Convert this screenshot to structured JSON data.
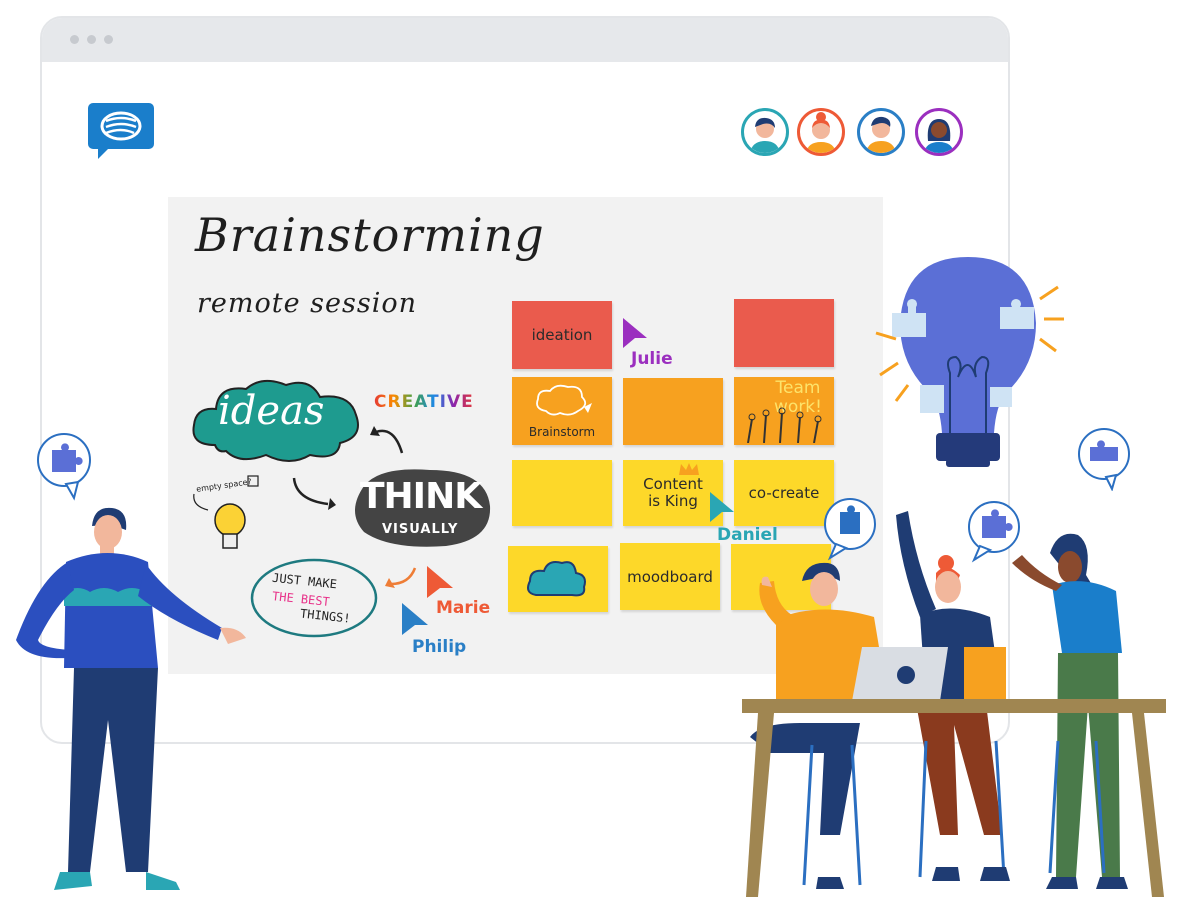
{
  "board": {
    "title": "Brainstorming",
    "subtitle": "remote session",
    "doodles": {
      "ideas": "ideas",
      "creative": "CREATIVE",
      "think": "THINK",
      "visually": "VISUALLY",
      "empty_space": "empty space?",
      "just_make_line1": "JUST MAKE",
      "just_make_line2": "THE BEST",
      "just_make_line3": "THINGS!"
    },
    "notes": [
      {
        "text": "ideation",
        "color": "#ea5b4d"
      },
      {
        "text": "",
        "color": "#ea5b4d"
      },
      {
        "text": "Brainstorm",
        "color": "#f7a11f"
      },
      {
        "text": "",
        "color": "#f7a11f"
      },
      {
        "text": "Team work!",
        "color": "#f7a11f"
      },
      {
        "text": "",
        "color": "#fdd829"
      },
      {
        "text": "Content is King",
        "color": "#fdd829"
      },
      {
        "text": "co-create",
        "color": "#fdd829"
      },
      {
        "text": "",
        "color": "#fdd829"
      },
      {
        "text": "moodboard",
        "color": "#fdd829"
      },
      {
        "text": "",
        "color": "#fdd829"
      }
    ],
    "cursors": [
      {
        "name": "Julie",
        "color": "#9b2fbf"
      },
      {
        "name": "Daniel",
        "color": "#2aa6b4"
      },
      {
        "name": "Marie",
        "color": "#ee5a36"
      },
      {
        "name": "Philip",
        "color": "#2a7fc6"
      }
    ]
  },
  "participants": {
    "avatar_ring_colors": [
      "#2aa6b4",
      "#ee5a36",
      "#2a7fc6",
      "#9b2fbf"
    ]
  },
  "icons": [
    "chat-logo-icon",
    "puzzle-icon",
    "lightbulb-icon"
  ]
}
